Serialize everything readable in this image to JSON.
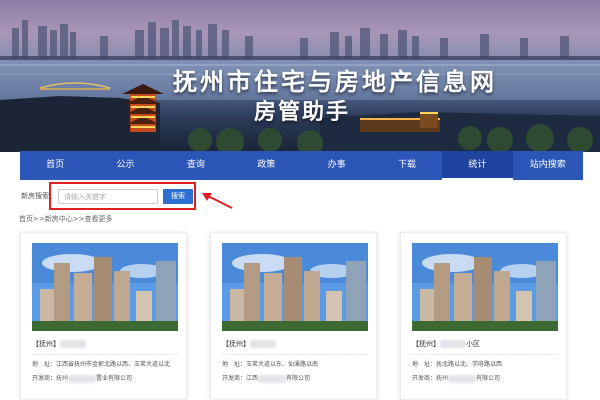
{
  "banner": {
    "title": "抚州市住宅与房地产信息网",
    "subtitle": "房管助手"
  },
  "nav": {
    "items": [
      "首页",
      "公示",
      "查询",
      "政策",
      "办事",
      "下载",
      "统计",
      "站内搜索"
    ],
    "active_index": 6
  },
  "search": {
    "label": "新房搜索",
    "placeholder": "请输入关键字",
    "button_label": "搜索"
  },
  "breadcrumb": "首页>>新房中心>>查看更多",
  "cards": [
    {
      "title": "【抚州】",
      "address": "地　址：江西省抚州市金柅北路以西、玉茗大道以北",
      "developer_prefix": "开发商：抚州",
      "developer_suffix": "置业有限公司"
    },
    {
      "title": "【抚州】",
      "address": "地　址：玉茗大道以东、仙溪路以南",
      "developer_prefix": "开发商：江西",
      "developer_suffix": "有限公司"
    },
    {
      "title": "【抚州】",
      "title_suffix": "小区",
      "address": "地　址：抚北路以北、学府路以西",
      "developer_prefix": "开发商：抚州",
      "developer_suffix": "有限公司"
    }
  ],
  "colors": {
    "nav_bg": "#2c56b8",
    "search_button": "#2c6fd0",
    "highlight_border": "#e02020"
  },
  "icons": [
    "arrow-left-icon"
  ]
}
